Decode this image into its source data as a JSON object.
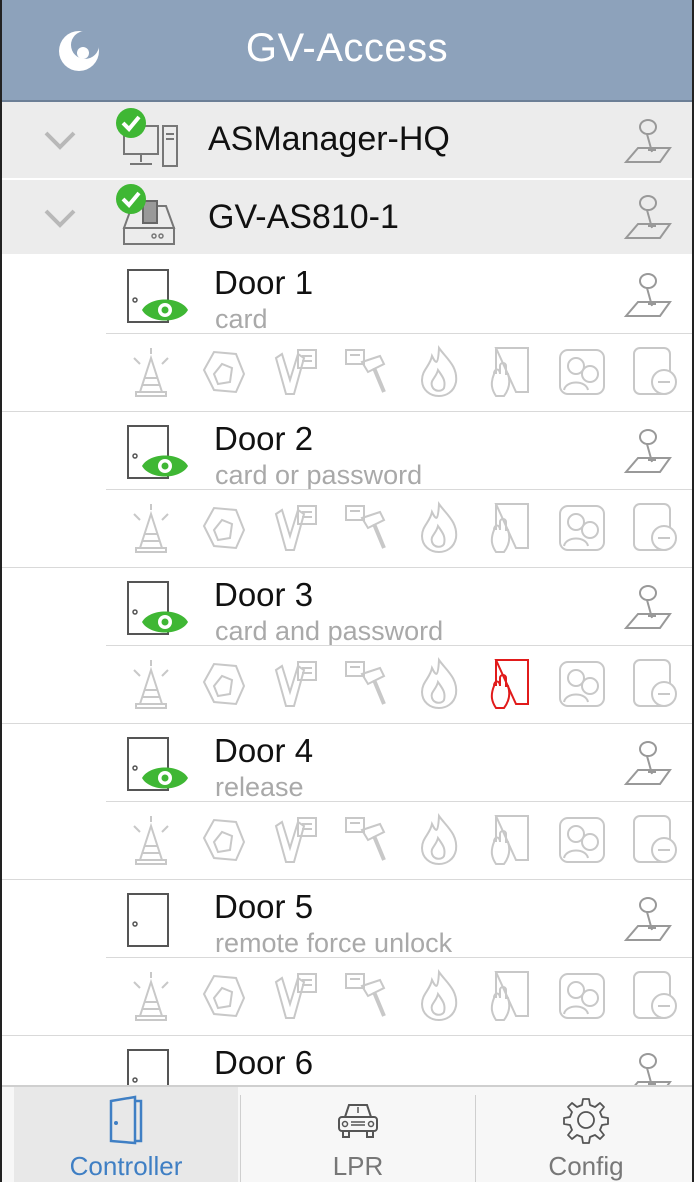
{
  "app": {
    "title": "GV-Access"
  },
  "servers": [
    {
      "name": "ASManager-HQ",
      "status": "connected",
      "icon": "computer-icon"
    },
    {
      "name": "GV-AS810-1",
      "status": "connected",
      "icon": "controller-device-icon"
    }
  ],
  "doors": [
    {
      "name": "Door 1",
      "mode": "card",
      "monitored": true,
      "active_action": ""
    },
    {
      "name": "Door 2",
      "mode": "card or password",
      "monitored": true,
      "active_action": ""
    },
    {
      "name": "Door 3",
      "mode": "card and password",
      "monitored": true,
      "active_action": "door-open-hand"
    },
    {
      "name": "Door 4",
      "mode": "release",
      "monitored": true,
      "active_action": ""
    },
    {
      "name": "Door 5",
      "mode": "remote force unlock",
      "monitored": false,
      "active_action": ""
    },
    {
      "name": "Door 6",
      "mode": "",
      "monitored": false,
      "active_action": ""
    }
  ],
  "door_action_icons": [
    "alarm-cone-icon",
    "forced-open-icon",
    "held-open-icon",
    "tamper-hammer-icon",
    "fire-icon",
    "door-open-hand-icon",
    "duress-people-icon",
    "door-minus-icon"
  ],
  "tabs": [
    {
      "label": "Controller",
      "icon": "door-icon",
      "selected": true
    },
    {
      "label": "LPR",
      "icon": "car-icon",
      "selected": false
    },
    {
      "label": "Config",
      "icon": "gear-icon",
      "selected": false
    }
  ],
  "colors": {
    "header": "#8da2bb",
    "accent": "#3f7fc4",
    "status_green": "#3fb734",
    "alert_red": "#e11b1b",
    "icon_gray": "#c8c8c8"
  }
}
